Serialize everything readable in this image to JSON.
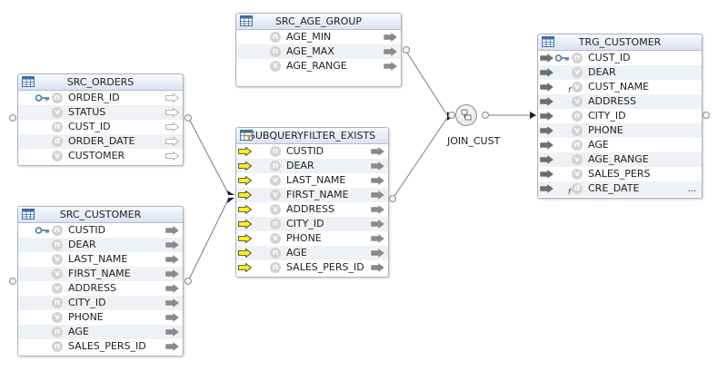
{
  "nodes": {
    "src_orders": {
      "title": "SRC_ORDERS",
      "columns": [
        {
          "name": "ORDER_ID",
          "type": "n",
          "key": true
        },
        {
          "name": "STATUS",
          "type": "v"
        },
        {
          "name": "CUST_ID",
          "type": "n"
        },
        {
          "name": "ORDER_DATE",
          "type": "d"
        },
        {
          "name": "CUSTOMER",
          "type": "v"
        }
      ]
    },
    "src_customer": {
      "title": "SRC_CUSTOMER",
      "columns": [
        {
          "name": "CUSTID",
          "type": "n",
          "key": true
        },
        {
          "name": "DEAR",
          "type": "n"
        },
        {
          "name": "LAST_NAME",
          "type": "v"
        },
        {
          "name": "FIRST_NAME",
          "type": "v"
        },
        {
          "name": "ADDRESS",
          "type": "v"
        },
        {
          "name": "CITY_ID",
          "type": "n"
        },
        {
          "name": "PHONE",
          "type": "v"
        },
        {
          "name": "AGE",
          "type": "n"
        },
        {
          "name": "SALES_PERS_ID",
          "type": "n"
        }
      ]
    },
    "src_age_group": {
      "title": "SRC_AGE_GROUP",
      "columns": [
        {
          "name": "AGE_MIN",
          "type": "n"
        },
        {
          "name": "AGE_MAX",
          "type": "n"
        },
        {
          "name": "AGE_RANGE",
          "type": "s"
        }
      ]
    },
    "subqueryfilter_exists": {
      "title": "SUBQUERYFILTER_EXISTS",
      "columns": [
        {
          "name": "CUSTID",
          "type": "n"
        },
        {
          "name": "DEAR",
          "type": "n"
        },
        {
          "name": "LAST_NAME",
          "type": "v"
        },
        {
          "name": "FIRST_NAME",
          "type": "v"
        },
        {
          "name": "ADDRESS",
          "type": "v"
        },
        {
          "name": "CITY_ID",
          "type": "n"
        },
        {
          "name": "PHONE",
          "type": "v"
        },
        {
          "name": "AGE",
          "type": "n"
        },
        {
          "name": "SALES_PERS_ID",
          "type": "n"
        }
      ]
    },
    "join_cust": {
      "label": "JOIN_CUST"
    },
    "trg_customer": {
      "title": "TRG_CUSTOMER",
      "columns": [
        {
          "name": "CUST_ID",
          "type": "n",
          "key": true
        },
        {
          "name": "DEAR",
          "type": "v"
        },
        {
          "name": "CUST_NAME",
          "type": "v",
          "fx": true
        },
        {
          "name": "ADDRESS",
          "type": "v"
        },
        {
          "name": "CITY_ID",
          "type": "n"
        },
        {
          "name": "PHONE",
          "type": "v"
        },
        {
          "name": "AGE",
          "type": "n"
        },
        {
          "name": "AGE_RANGE",
          "type": "v"
        },
        {
          "name": "SALES_PERS",
          "type": "v"
        },
        {
          "name": "CRE_DATE",
          "type": "d",
          "fx": true
        }
      ],
      "more_indicator": "..."
    }
  },
  "icons": {
    "datastore": "table-grid-icon",
    "subquery": "subquery-filter-icon",
    "join": "join-icon",
    "key": "primary-key-icon",
    "in_arrow": "input-attribute-arrow-icon",
    "out_arrow": "output-attribute-arrow-icon"
  },
  "colors": {
    "header_top": "#f7f9fd",
    "header_bottom": "#dbe3ef",
    "border": "#a9b4c4",
    "type_icon": "#d3d3d3",
    "arrow_gray": "#8a8a8a",
    "arrow_outline": "#b4b4b4",
    "arrow_yellow": "#ffee1a",
    "key_blue": "#3f6fa6",
    "link_line": "#777777"
  }
}
